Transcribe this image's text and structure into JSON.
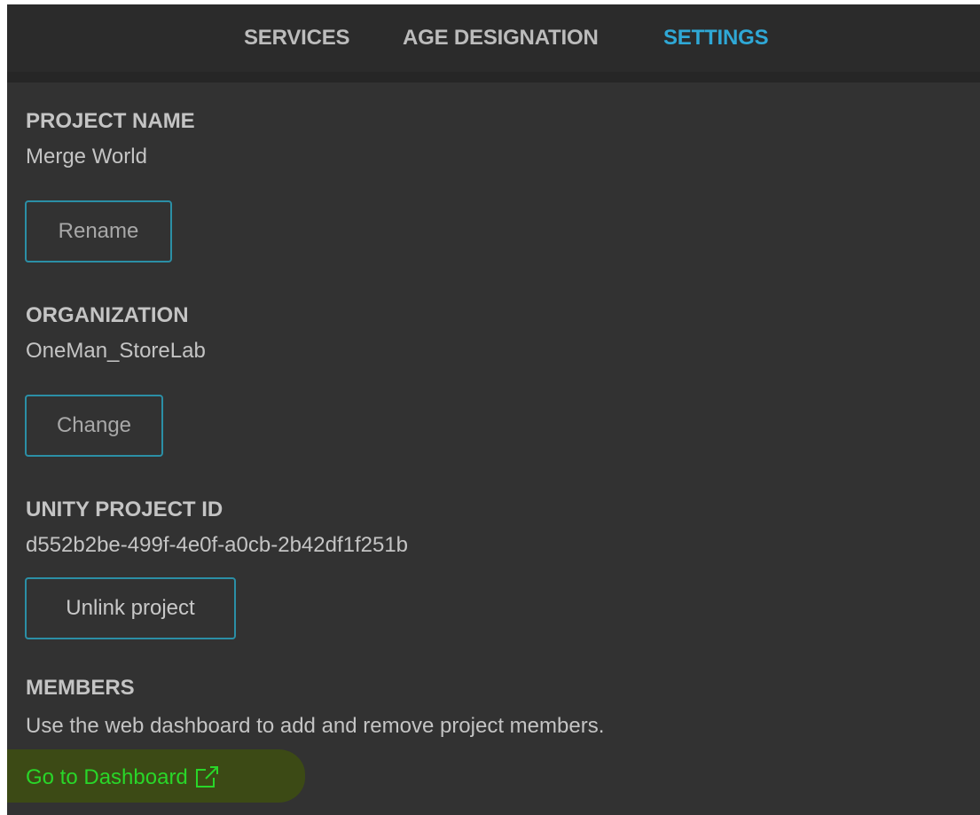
{
  "tabs": [
    {
      "label": "SERVICES",
      "active": false
    },
    {
      "label": "AGE DESIGNATION",
      "active": false
    },
    {
      "label": "SETTINGS",
      "active": true
    }
  ],
  "project_name": {
    "heading": "PROJECT NAME",
    "value": "Merge World",
    "button_label": "Rename"
  },
  "organization": {
    "heading": "ORGANIZATION",
    "value": "OneMan_StoreLab",
    "button_label": "Change"
  },
  "unity_project_id": {
    "heading": "UNITY PROJECT ID",
    "value": "d552b2be-499f-4e0f-a0cb-2b42df1f251b",
    "button_label": "Unlink project"
  },
  "members": {
    "heading": "MEMBERS",
    "description": "Use the web dashboard to add and remove project members.",
    "link_label": "Go to Dashboard",
    "link_icon": "external-link-icon"
  },
  "colors": {
    "background": "#323232",
    "tab_bar": "#2b2b2b",
    "active_tab": "#2fa8d6",
    "button_border": "#2b8fa6",
    "link": "#29d629",
    "link_highlight": "#3c4a15"
  }
}
